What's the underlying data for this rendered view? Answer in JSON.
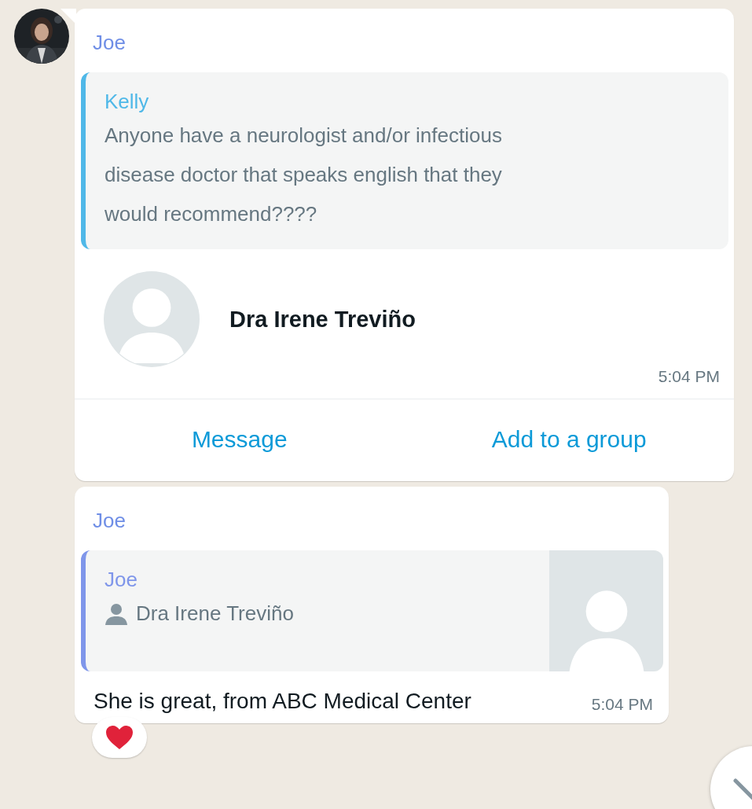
{
  "messages": [
    {
      "kind": "contact",
      "sender": "Joe",
      "show_avatar": true,
      "quote": {
        "kind": "text",
        "author": "Kelly",
        "color": "#4fb8e8",
        "text": "Anyone have a neurologist and/or infectious disease doctor that speaks english that they would recommend????"
      },
      "contact": {
        "name": "Dra Irene Treviño"
      },
      "time": "5:04 PM",
      "actions": [
        "Message",
        "Add to a group"
      ]
    },
    {
      "kind": "text",
      "sender": "Joe",
      "show_avatar": false,
      "quote": {
        "kind": "contact",
        "author": "Joe",
        "color": "#7f96ea",
        "text": "Dra Irene Treviño"
      },
      "text": "She is great, from ABC Medical Center",
      "time": "5:04 PM",
      "reacted": true
    }
  ]
}
